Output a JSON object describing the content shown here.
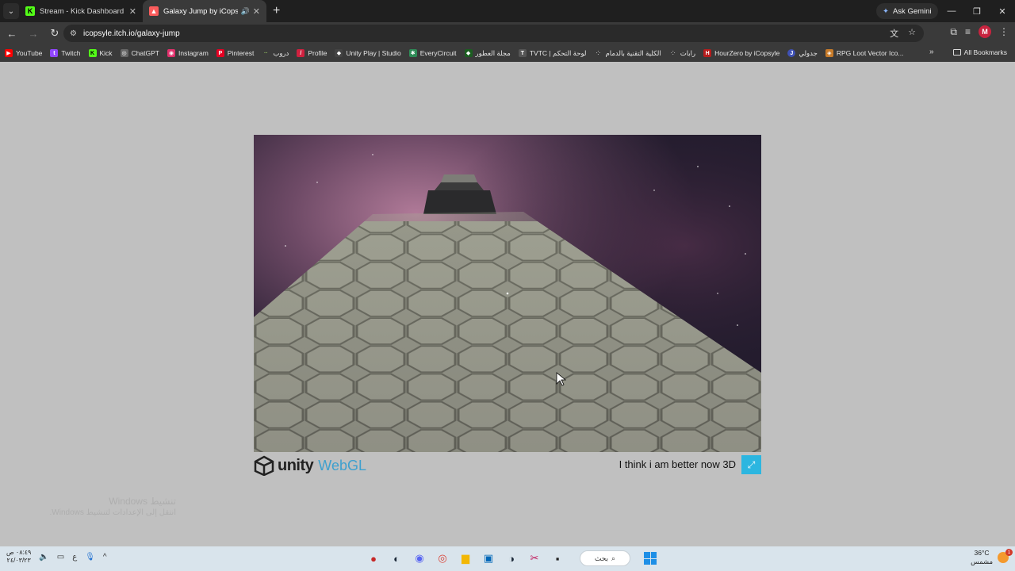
{
  "browser": {
    "tabs": [
      {
        "title": "Stream - Kick Dashboard",
        "favicon": "kick-icon",
        "active": false
      },
      {
        "title": "Galaxy Jump by iCopsyle",
        "favicon": "itch-icon",
        "active": true
      }
    ],
    "ask_gemini": "Ask Gemini",
    "url": "icopsyle.itch.io/galaxy-jump",
    "profile_initial": "M"
  },
  "bookmarks": {
    "items": [
      {
        "label": "YouTube",
        "color": "#ff0000"
      },
      {
        "label": "Twitch",
        "color": "#9146ff"
      },
      {
        "label": "Kick",
        "color": "#53fc18"
      },
      {
        "label": "ChatGPT",
        "color": "#666666"
      },
      {
        "label": "Instagram",
        "color": "#e1306c"
      },
      {
        "label": "Pinterest",
        "color": "#e60023"
      },
      {
        "label": "دروب",
        "color": "#888888"
      },
      {
        "label": "Profile",
        "color": "#d0213f"
      },
      {
        "label": "Unity Play | Studio",
        "color": "#444444"
      },
      {
        "label": "EveryCircuit",
        "color": "#2e8b57"
      },
      {
        "label": "مجلة العطور",
        "color": "#1b5e20"
      },
      {
        "label": "TVTC | لوحة التحكم",
        "color": "#555555"
      },
      {
        "label": "الكلية التقنية بالدمام",
        "color": "#777777"
      },
      {
        "label": "رابات",
        "color": "#777777"
      },
      {
        "label": "HourZero by iCopsyle",
        "color": "#b71c1c"
      },
      {
        "label": "جدولي",
        "color": "#3f51b5"
      },
      {
        "label": "RPG Loot Vector Ico...",
        "color": "#c77b2a"
      }
    ],
    "all_bookmarks": "All Bookmarks"
  },
  "game": {
    "engine_word": "unity",
    "webgl_word": "WebGL",
    "title": "I think i am better now 3D"
  },
  "watermark": {
    "line1": "تنشيط Windows",
    "line2": "انتقل إلى الإعدادات لتنشيط Windows."
  },
  "taskbar": {
    "time": "٠٨:٤٩ ص",
    "date": "٢٤/٠٣/٢٣",
    "lang": "ع",
    "search_label": "بحث",
    "temperature": "36°C",
    "weather_desc": "مشمس",
    "notification_count": "1"
  }
}
